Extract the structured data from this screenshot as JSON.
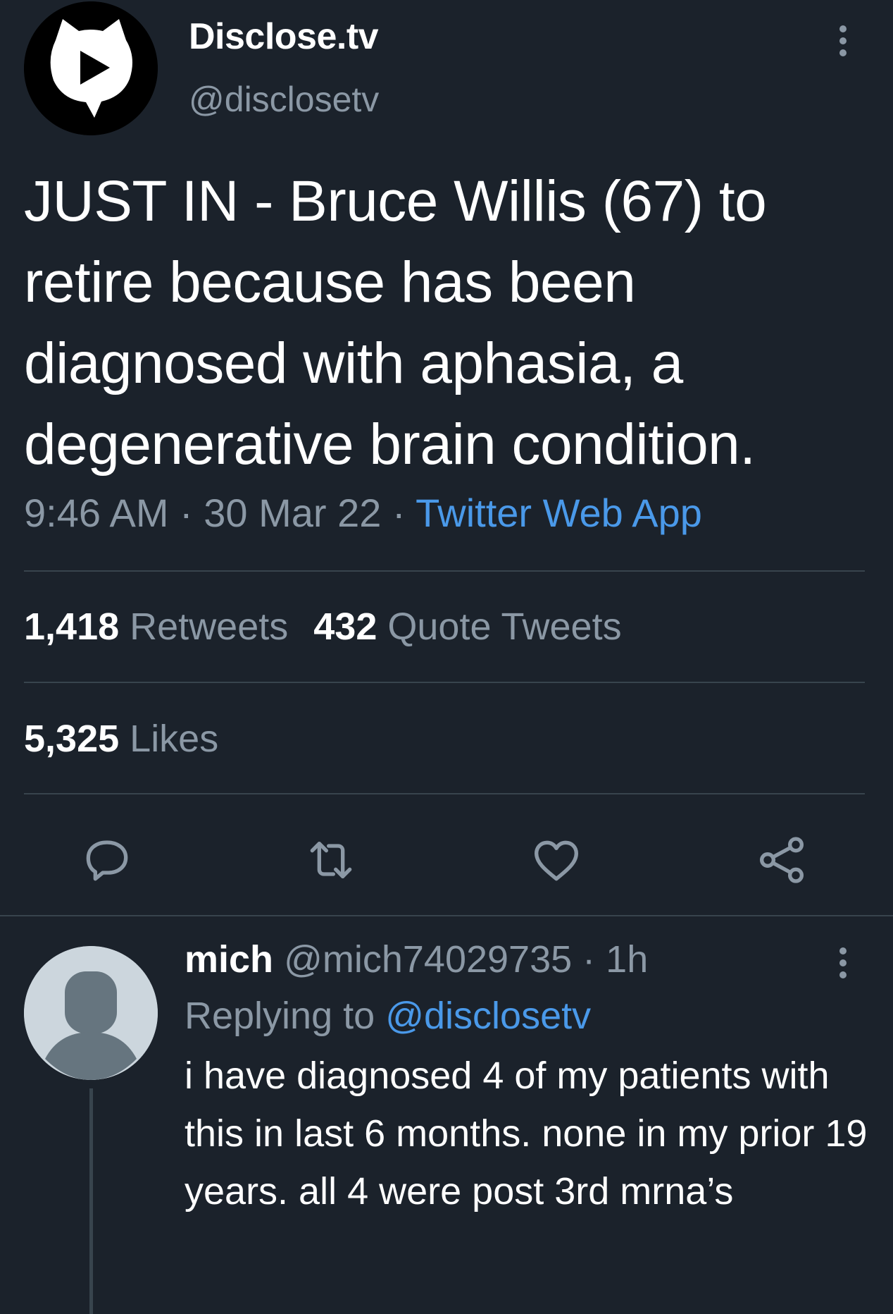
{
  "tweet": {
    "author_name": "Disclose.tv",
    "author_handle": "@disclosetv",
    "text": "JUST IN - Bruce Willis (67) to retire because has been diagnosed with aphasia, a degenerative brain condition.",
    "time": "9:46 AM",
    "separator": "·",
    "date": "30 Mar 22",
    "app": "Twitter Web App",
    "retweets_count": "1,418",
    "retweets_label": "Retweets",
    "quotes_count": "432",
    "quotes_label": "Quote Tweets",
    "likes_count": "5,325",
    "likes_label": "Likes",
    "actions": [
      "reply-icon",
      "retweet-icon",
      "like-icon",
      "share-icon"
    ]
  },
  "reply": {
    "author_name": "mich",
    "author_handle": "@mich74029735",
    "separator": "·",
    "time": "1h",
    "replying_prefix": "Replying to",
    "replying_to": "@disclosetv",
    "text": "i have diagnosed 4 of my patients with this in last 6 months. none in my prior 19 years. all 4 were post 3rd mrna’s"
  },
  "colors": {
    "background": "#1b222b",
    "text_primary": "#ffffff",
    "text_secondary": "#8b98a5",
    "link": "#4a99e9",
    "divider": "#38444d"
  }
}
